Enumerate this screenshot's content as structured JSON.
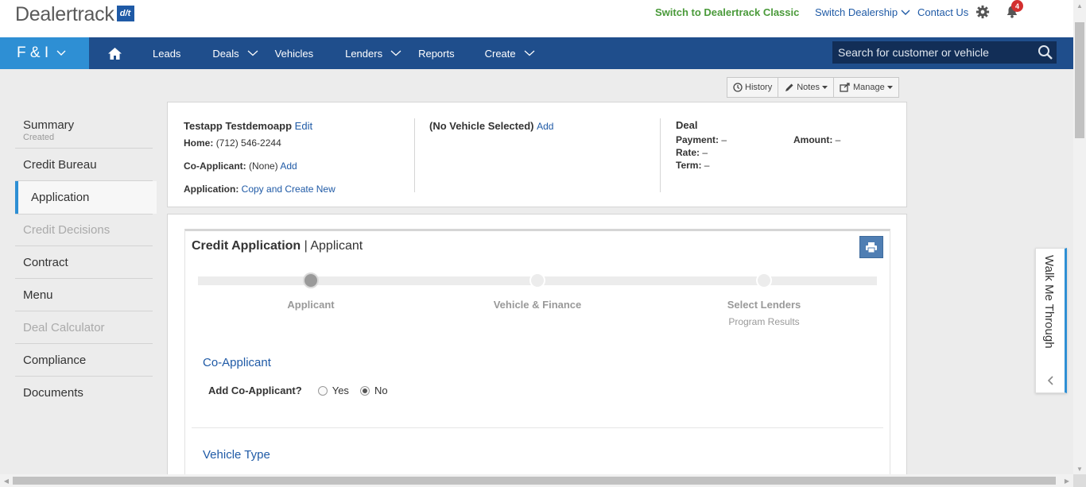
{
  "header": {
    "logo_text": "Dealertrack",
    "logo_mark": "d/t",
    "switch_classic": "Switch to Dealertrack Classic",
    "switch_dealership": "Switch Dealership",
    "contact_us": "Contact Us",
    "notification_count": "4"
  },
  "nav": {
    "module": "F & I",
    "items": [
      {
        "label": "Leads",
        "dropdown": false
      },
      {
        "label": "Deals",
        "dropdown": true
      },
      {
        "label": "Vehicles",
        "dropdown": false
      },
      {
        "label": "Lenders",
        "dropdown": true
      },
      {
        "label": "Reports",
        "dropdown": false
      },
      {
        "label": "Create",
        "dropdown": true
      }
    ],
    "search_placeholder": "Search for customer or vehicle"
  },
  "toolbar": {
    "history": "History",
    "notes": "Notes",
    "manage": "Manage"
  },
  "sidebar": {
    "summary": "Summary",
    "summary_status": "Created",
    "items": [
      {
        "label": "Credit Bureau"
      },
      {
        "label": "Application"
      },
      {
        "label": "Credit Decisions"
      },
      {
        "label": "Contract"
      },
      {
        "label": "Menu"
      },
      {
        "label": "Deal Calculator"
      },
      {
        "label": "Compliance"
      },
      {
        "label": "Documents"
      }
    ]
  },
  "deal_info": {
    "customer_name": "Testapp Testdemoapp",
    "edit": "Edit",
    "home_label": "Home:",
    "home_phone": "(712) 546-2244",
    "co_applicant_label": "Co-Applicant:",
    "co_applicant_value": "(None)",
    "add": "Add",
    "application_label": "Application:",
    "copy_create": "Copy and Create New",
    "vehicle": "(No Vehicle Selected)",
    "vehicle_add": "Add",
    "deal_title": "Deal",
    "payment_label": "Payment:",
    "payment_value": "–",
    "amount_label": "Amount:",
    "amount_value": "–",
    "rate_label": "Rate:",
    "rate_value": "–",
    "term_label": "Term:",
    "term_value": "–"
  },
  "credit_app": {
    "title": "Credit Application",
    "subtitle": "| Applicant",
    "steps": [
      {
        "label": "Applicant",
        "sub": ""
      },
      {
        "label": "Vehicle & Finance",
        "sub": ""
      },
      {
        "label": "Select Lenders",
        "sub": "Program Results"
      }
    ],
    "current_step": 1,
    "co_applicant_heading": "Co-Applicant",
    "add_co_applicant_label": "Add Co-Applicant?",
    "yes": "Yes",
    "no": "No",
    "selected": "No",
    "vehicle_type_heading": "Vehicle Type"
  },
  "walkme": {
    "label": "Walk Me Through"
  },
  "colors": {
    "nav_bg": "#1f4e8c",
    "module_bg": "#2e8fd4",
    "link": "#1f5aa6",
    "classic_green": "#4a9a3a"
  }
}
